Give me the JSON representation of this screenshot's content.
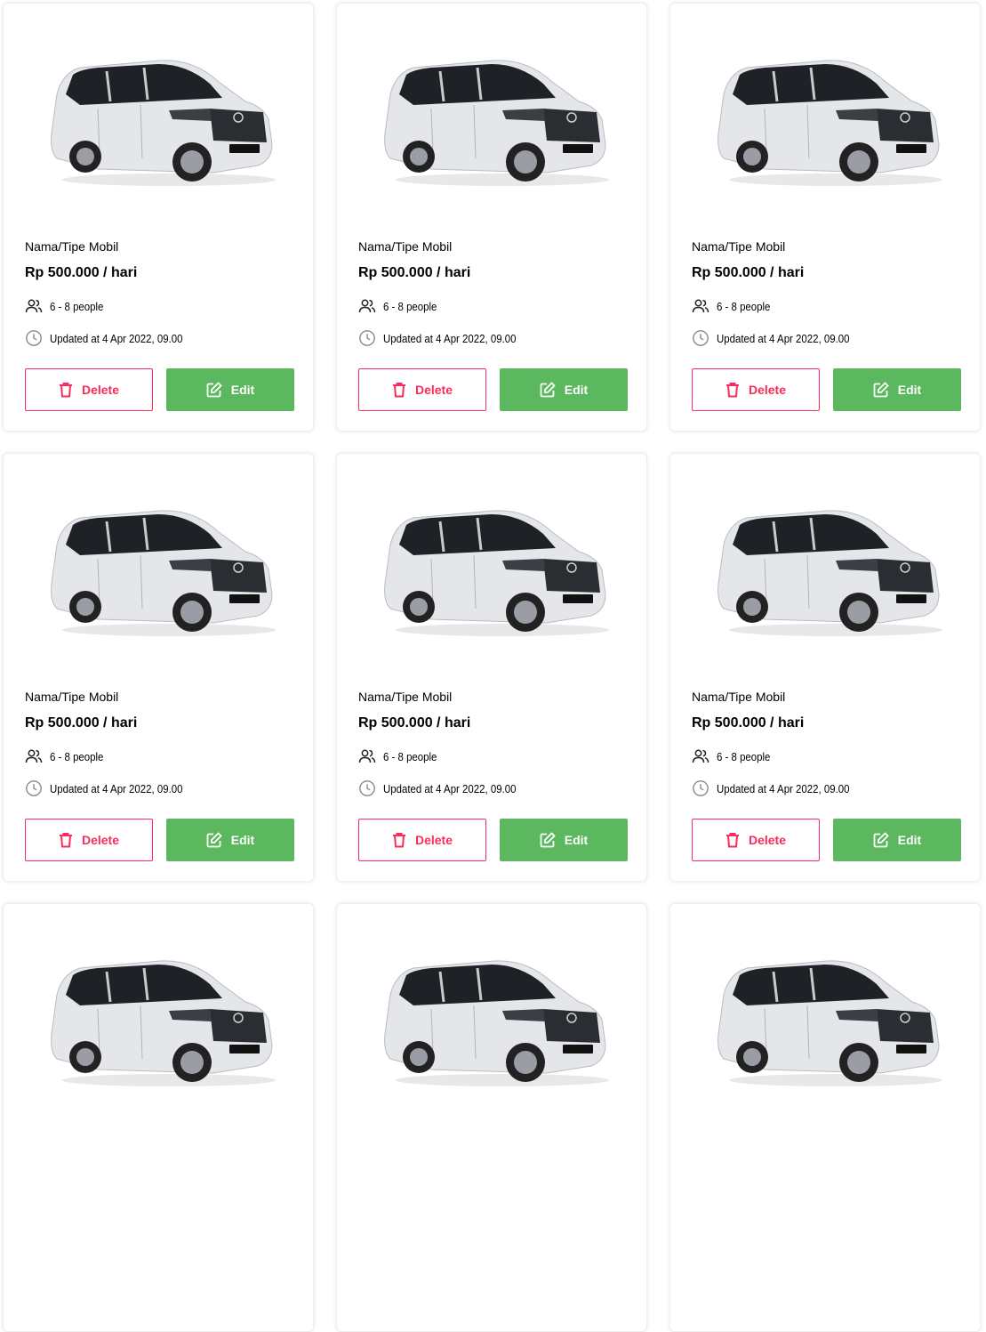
{
  "colors": {
    "danger": "#FA2C5A",
    "success": "#5CB85F",
    "text": "#000000",
    "muted": "#8A8A8A"
  },
  "cards": [
    {
      "name": "Nama/Tipe Mobil",
      "price": "Rp 500.000 / hari",
      "capacity": "6 - 8 people",
      "updated": "Updated at 4 Apr 2022, 09.00",
      "delete_label": "Delete",
      "edit_label": "Edit",
      "image": "toyota-innova-car-image"
    },
    {
      "name": "Nama/Tipe Mobil",
      "price": "Rp 500.000 / hari",
      "capacity": "6 - 8 people",
      "updated": "Updated at 4 Apr 2022, 09.00",
      "delete_label": "Delete",
      "edit_label": "Edit",
      "image": "toyota-innova-car-image"
    },
    {
      "name": "Nama/Tipe Mobil",
      "price": "Rp 500.000 / hari",
      "capacity": "6 - 8 people",
      "updated": "Updated at 4 Apr 2022, 09.00",
      "delete_label": "Delete",
      "edit_label": "Edit",
      "image": "toyota-innova-car-image"
    },
    {
      "name": "Nama/Tipe Mobil",
      "price": "Rp 500.000 / hari",
      "capacity": "6 - 8 people",
      "updated": "Updated at 4 Apr 2022, 09.00",
      "delete_label": "Delete",
      "edit_label": "Edit",
      "image": "toyota-innova-car-image"
    },
    {
      "name": "Nama/Tipe Mobil",
      "price": "Rp 500.000 / hari",
      "capacity": "6 - 8 people",
      "updated": "Updated at 4 Apr 2022, 09.00",
      "delete_label": "Delete",
      "edit_label": "Edit",
      "image": "toyota-innova-car-image"
    },
    {
      "name": "Nama/Tipe Mobil",
      "price": "Rp 500.000 / hari",
      "capacity": "6 - 8 people",
      "updated": "Updated at 4 Apr 2022, 09.00",
      "delete_label": "Delete",
      "edit_label": "Edit",
      "image": "toyota-innova-car-image"
    },
    {
      "image": "toyota-innova-car-image"
    },
    {
      "image": "toyota-innova-car-image"
    },
    {
      "image": "toyota-innova-car-image"
    }
  ]
}
